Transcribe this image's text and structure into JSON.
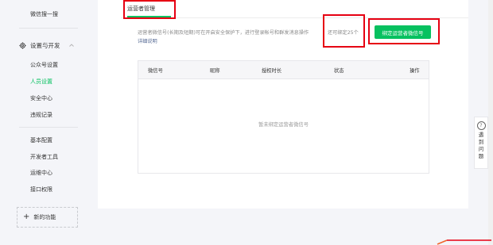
{
  "sidebar": {
    "top_item": "微信搜一搜",
    "group_title": "设置与开发",
    "items_group1": [
      {
        "label": "公众号设置"
      },
      {
        "label": "人员设置"
      },
      {
        "label": "安全中心"
      },
      {
        "label": "违规记录"
      }
    ],
    "items_group2": [
      {
        "label": "基本配置"
      },
      {
        "label": "开发者工具"
      },
      {
        "label": "运维中心"
      },
      {
        "label": "接口权限"
      }
    ],
    "new_feature": "新的功能"
  },
  "tabs": {
    "active": "运营者管理"
  },
  "main": {
    "description": "运营者微信号(长期及短期)可在开启安全保护下，进行登录帐号和群发消息操作",
    "desc_link": "详细说明",
    "remaining": "还可绑定25个",
    "bind_button": "绑定运营者微信号",
    "table": {
      "headers": [
        "微信号",
        "昵称",
        "授权时长",
        "状态",
        "操作"
      ],
      "empty_text": "暂未绑定运营者微信号"
    }
  },
  "help": {
    "label": "遇到问题"
  },
  "colors": {
    "accent": "#07c160",
    "annotation_red": "#e60012",
    "link": "#576b95"
  }
}
